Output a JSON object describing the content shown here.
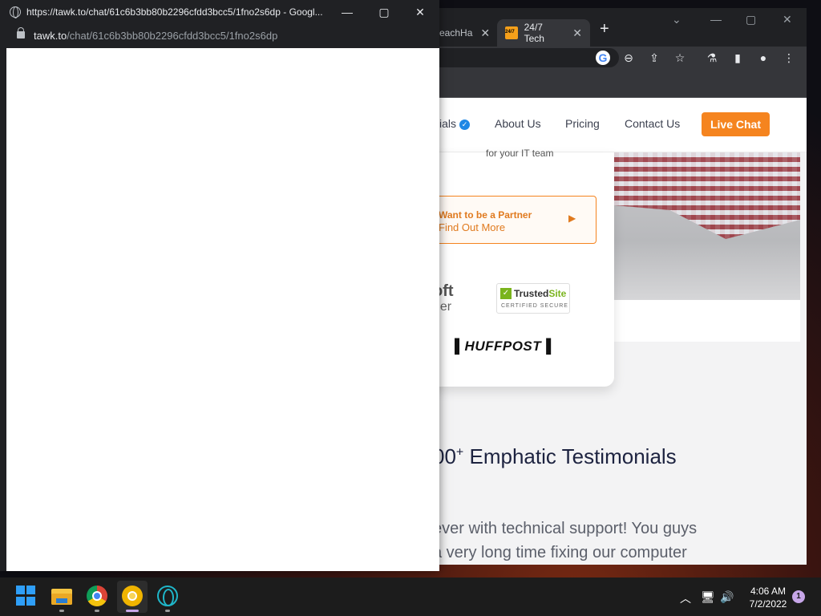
{
  "popup": {
    "title": "https://tawk.to/chat/61c6b3bb80b2296cfdd3bcc5/1fno2s6dp - Googl...",
    "url_host": "tawk.to",
    "url_path": "/chat/61c6b3bb80b2296cfdd3bcc5/1fno2s6dp"
  },
  "background_browser": {
    "tabs": [
      {
        "label": "eachHa"
      },
      {
        "label": "24/7 Tech"
      }
    ]
  },
  "site": {
    "nav": {
      "partial_item": "ials",
      "about": "About Us",
      "pricing": "Pricing",
      "contact": "Contact Us",
      "live_chat": "Live Chat"
    },
    "card_text": "for your IT team",
    "partner": {
      "line1": "Want to be a Partner",
      "line2": "Find Out More"
    },
    "logos": {
      "ms_top": "oft",
      "ms_bottom": "ner",
      "trusted_name_a": "Trusted",
      "trusted_name_b": "Site",
      "trusted_sub": "CERTIFIED SECURE",
      "huffpost": "HUFFPOST"
    },
    "testimonials": {
      "title_prefix": "00",
      "title_sup": "+",
      "title_rest": " Emphatic Testimonials",
      "line1": "ever with technical support! You guys",
      "line2": "a very long time fixing our computer"
    }
  },
  "taskbar": {
    "time": "4:06 AM",
    "date": "7/2/2022",
    "notifications": "1"
  }
}
